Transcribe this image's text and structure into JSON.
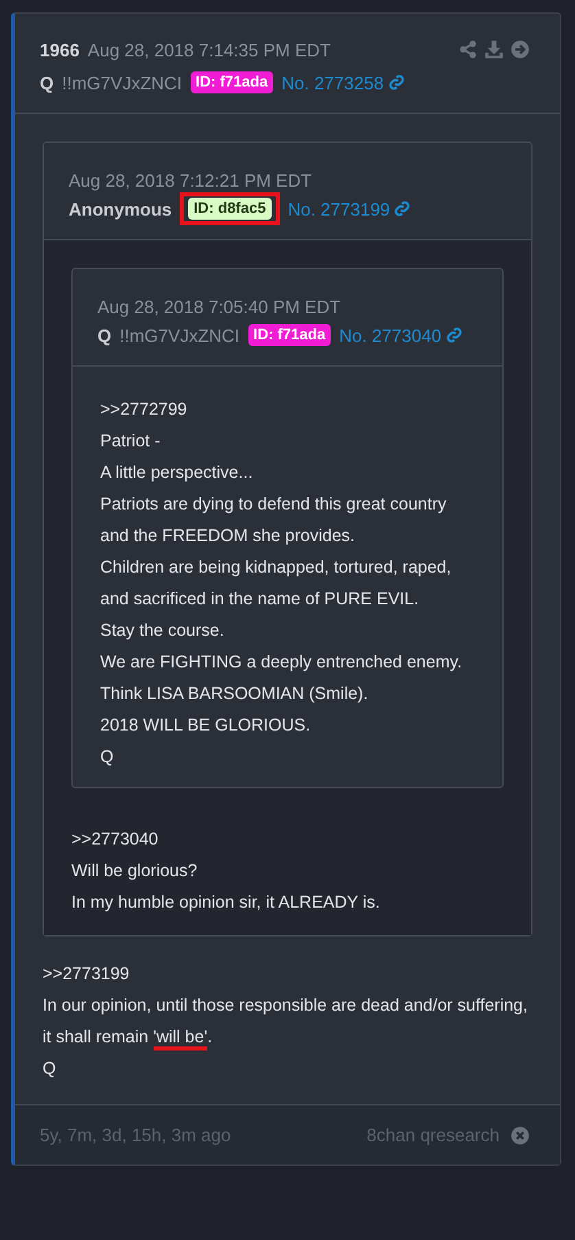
{
  "post": {
    "number": "1966",
    "timestamp": "Aug 28, 2018 7:14:35 PM EDT",
    "author": "Q",
    "tripcode": "!!mG7VJxZNCI",
    "id_badge": {
      "text": "ID: f71ada",
      "color": "#f01dd4",
      "highlighted": false
    },
    "post_no": "No. 2773258",
    "quote": {
      "timestamp": "Aug 28, 2018 7:12:21 PM EDT",
      "author": "Anonymous",
      "id_badge": {
        "text": "ID: d8fac5",
        "color": "#d8fac5",
        "highlighted": true
      },
      "post_no": "No. 2773199",
      "quote": {
        "timestamp": "Aug 28, 2018 7:05:40 PM EDT",
        "author": "Q",
        "tripcode": "!!mG7VJxZNCI",
        "id_badge": {
          "text": "ID: f71ada",
          "color": "#f01dd4",
          "highlighted": false
        },
        "post_no": "No. 2773040",
        "body": [
          {
            "text": ">>2772799"
          },
          {
            "text": "Patriot -"
          },
          {
            "text": "A little perspective..."
          },
          {
            "text": "Patriots are dying to defend this great country and the FREEDOM she provides."
          },
          {
            "text": "Children are being kidnapped, tortured, raped, and sacrificed in the name of PURE EVIL."
          },
          {
            "text": "Stay the course."
          },
          {
            "text": "We are FIGHTING a deeply entrenched enemy."
          },
          {
            "text": "Think LISA BARSOOMIAN (Smile)."
          },
          {
            "text": "2018 WILL BE GLORIOUS."
          },
          {
            "text": "Q"
          }
        ]
      },
      "body": [
        {
          "text": ">>2773040"
        },
        {
          "text": "Will be glorious?"
        },
        {
          "text": "In my humble opinion sir, it ALREADY is."
        }
      ]
    },
    "body": [
      {
        "text": ">>2773199"
      },
      {
        "text": "In our opinion, until those responsible are dead and/or suffering, it shall remain ",
        "marked": "'will be'",
        "after": "."
      },
      {
        "text": "Q"
      }
    ],
    "age": "5y, 7m, 3d, 15h, 3m ago",
    "source": "8chan qresearch"
  }
}
